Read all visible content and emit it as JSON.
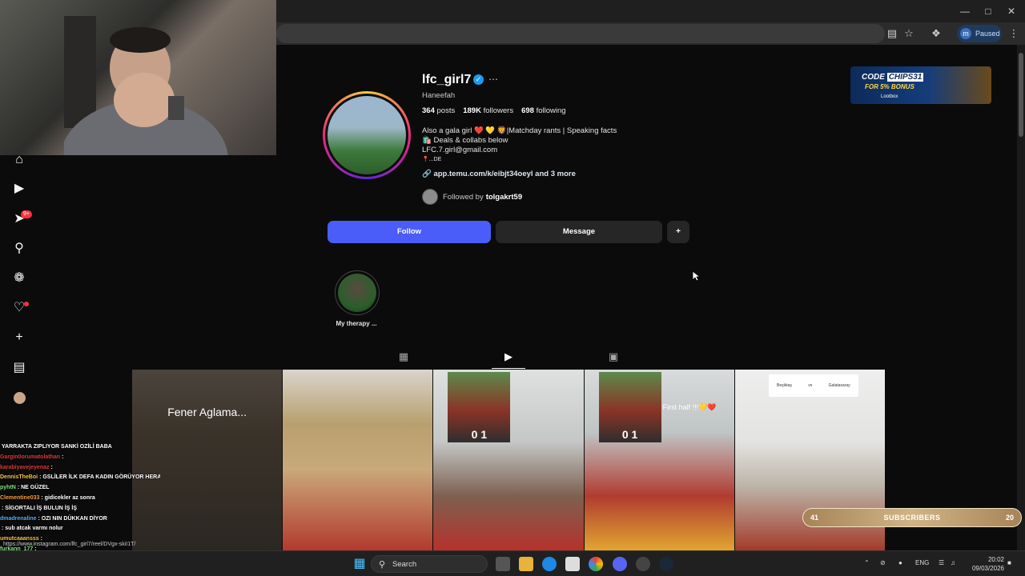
{
  "browser": {
    "profile_label": "Paused",
    "profile_initial": "m"
  },
  "sidebar": {
    "notifications_badge": "9+"
  },
  "profile": {
    "username": "lfc_girl7",
    "full_name": "Haneefah",
    "posts_count": "364",
    "posts_label": "posts",
    "followers_count": "189K",
    "followers_label": "followers",
    "following_count": "698",
    "following_label": "following",
    "bio_lines": [
      "Also a gala girl ❤️ 💛 🦁|Matchday rants | Speaking facts",
      "🛍️ Deals & collabs below",
      "LFC.7.girl@gmail.com",
      "📍...DE"
    ],
    "link": "app.temu.com/k/eibjt34oeyl and 3 more",
    "followed_by_prefix": "Followed by",
    "followed_by_user": "tolgakrt59",
    "follow_button": "Follow",
    "message_button": "Message",
    "highlight_label": "My therapy ..."
  },
  "ad": {
    "code_prefix": "CODE",
    "code": "CHIPS31",
    "bonus": "FOR 5% BONUS",
    "brand": "Lootbox"
  },
  "grid": {
    "cell1_text": "Fener Aglama...",
    "cell3_score": "0 1",
    "cell4_score": "0 1",
    "cell4_text": "First half !!!💛❤️",
    "cell5_left": "Beşiktaş",
    "cell5_mid": "vs",
    "cell5_right": "Galatasaray"
  },
  "chat": [
    {
      "user": "",
      "text": "YARRAKTA ZIPLIYOR SANKİ OZİLİ BABA",
      "color": "#ffffff"
    },
    {
      "user": "Gargin0orumatolathan",
      "text": ":",
      "color": "#d83a3a"
    },
    {
      "user": "karabiyavejeyenaz",
      "text": ":",
      "color": "#d83a3a"
    },
    {
      "user": "DennisTheBoi",
      "text": ": GSLİLER İLK DEFA KADIN GÖRÜYOR HERALDE",
      "color": "#f6c244"
    },
    {
      "user": "pyhtN",
      "text": ": NE GÜZEL",
      "color": "#7ce37c"
    },
    {
      "user": "Clementine033",
      "text": ": gidicekler az sonra",
      "color": "#f39c3c"
    },
    {
      "user": "",
      "text": ": SİGORTALI İŞ BULUN İŞ İŞ",
      "color": "#d83a3a"
    },
    {
      "user": "dmadrenaline",
      "text": ": OZI NIN DÜKKAN DİYOR",
      "color": "#5aa8f0"
    },
    {
      "user": "",
      "text": ": sub atcak varmı nolur",
      "color": "#ffffff"
    },
    {
      "user": "umutcaaansss",
      "text": ":",
      "color": "#f6c244"
    },
    {
      "user": "furkann_177",
      "text": ":",
      "color": "#7ce37c"
    }
  ],
  "url_status": "https://www.instagram.com/lfc_girl7/reel/DVgx-skiI1T/",
  "subscribers": {
    "left": "41",
    "label": "SUBSCRIBERS",
    "right": "20"
  },
  "taskbar": {
    "search_label": "Search",
    "language": "ENG",
    "time": "20:02",
    "date": "09/03/2026"
  }
}
